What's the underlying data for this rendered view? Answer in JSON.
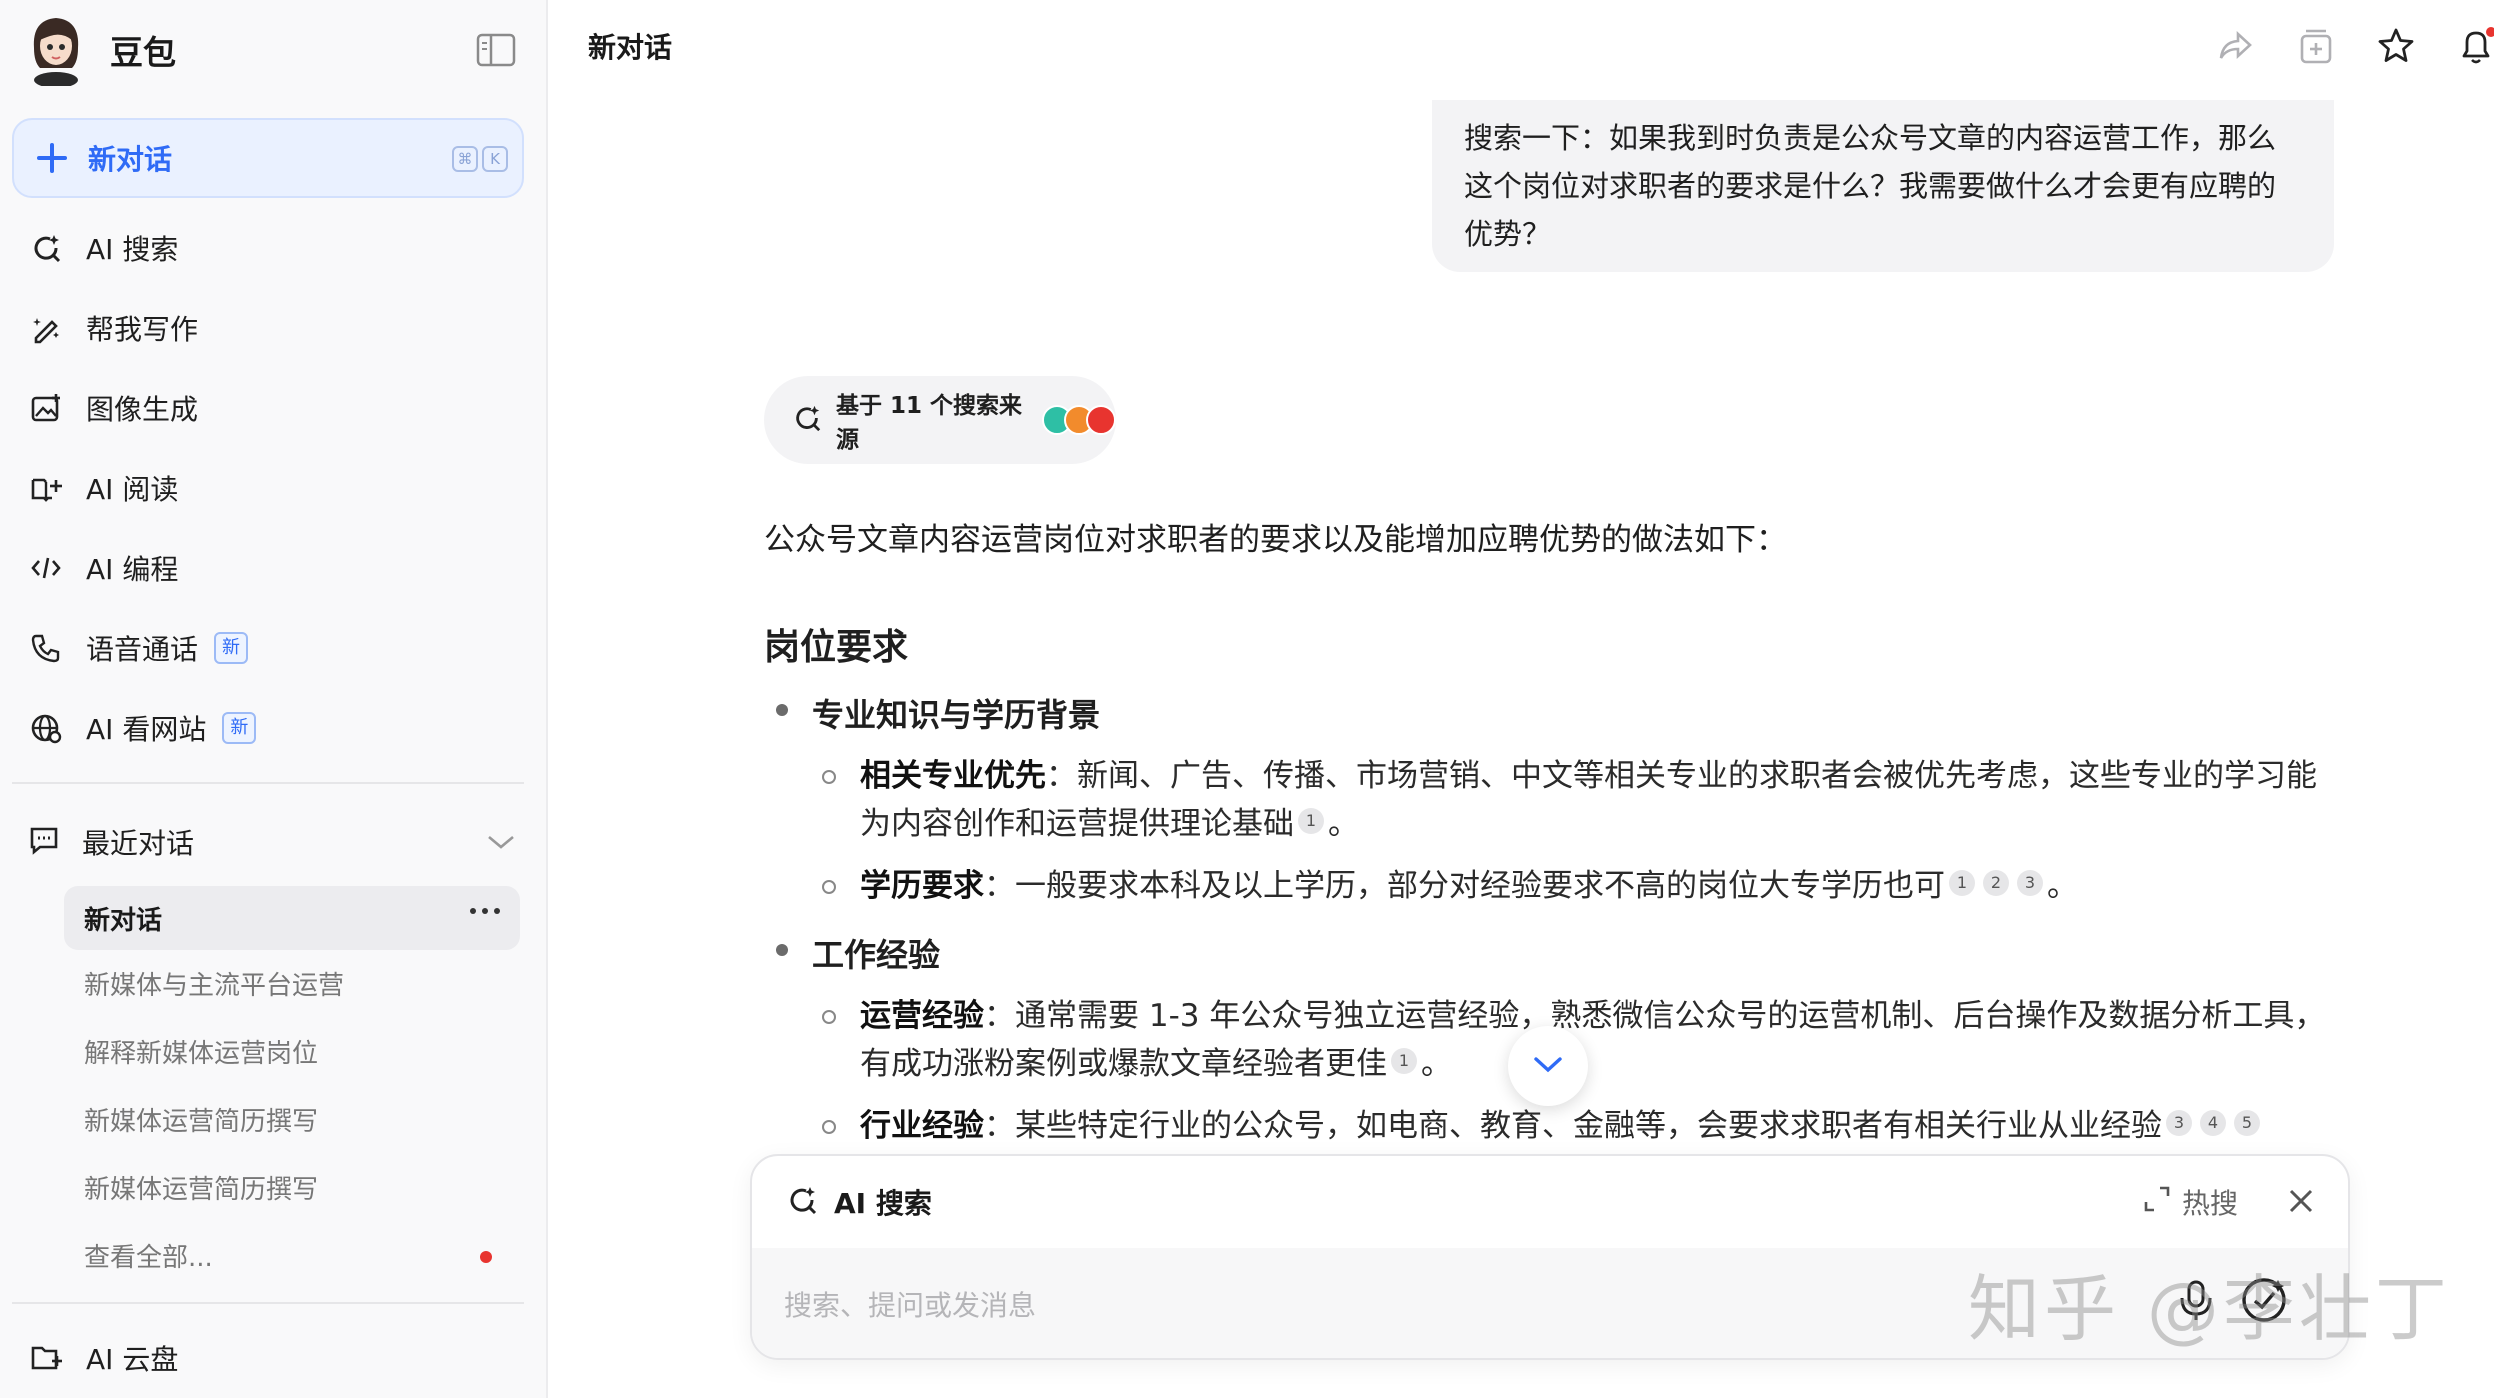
{
  "sidebar": {
    "brand": "豆包",
    "new_chat": "新对话",
    "shortcut": [
      "⌘",
      "K"
    ],
    "nav": [
      {
        "label": "AI 搜索",
        "icon": "ai-search-icon"
      },
      {
        "label": "帮我写作",
        "icon": "write-icon"
      },
      {
        "label": "图像生成",
        "icon": "image-gen-icon"
      },
      {
        "label": "AI 阅读",
        "icon": "read-icon"
      },
      {
        "label": "AI 编程",
        "icon": "code-icon"
      },
      {
        "label": "语音通话",
        "icon": "phone-icon",
        "badge": "新"
      },
      {
        "label": "AI 看网站",
        "icon": "globe-icon",
        "badge": "新"
      }
    ],
    "recent_title": "最近对话",
    "recent": [
      "新对话",
      "新媒体与主流平台运营",
      "解释新媒体运营岗位",
      "新媒体运营简历撰写",
      "新媒体运营简历撰写",
      "查看全部..."
    ],
    "cloud": "AI 云盘"
  },
  "main": {
    "title": "新对话",
    "user_message": "搜索一下：如果我到时负责是公众号文章的内容运营工作，那么这个岗位对求职者的要求是什么？我需要做什么才会更有应聘的优势？",
    "sources": "基于 11 个搜索来源",
    "intro": "公众号文章内容运营岗位对求职者的要求以及能增加应聘优势的做法如下：",
    "heading": "岗位要求",
    "sections": [
      {
        "title": "专业知识与学历背景",
        "items": [
          {
            "bold": "相关专业优先",
            "text": "：新闻、广告、传播、市场营销、中文等相关专业的求职者会被优先考虑，这些专业的学习能为内容创作和运营提供理论基础",
            "cites": [
              "1"
            ],
            "end": "。"
          },
          {
            "bold": "学历要求",
            "text": "：一般要求本科及以上学历，部分对经验要求不高的岗位大专学历也可",
            "cites": [
              "1",
              "2",
              "3"
            ],
            "end": "。"
          }
        ]
      },
      {
        "title": "工作经验",
        "items": [
          {
            "bold": "运营经验",
            "text": "：通常需要 1-3 年公众号独立运营经验，熟悉微信公众号的运营机制、后台操作及数据分析工具，有成功涨粉案例或爆款文章经验者更佳",
            "cites": [
              "1"
            ],
            "end": "。"
          },
          {
            "bold": "行业经验",
            "text": "：某些特定行业的公众号，如电商、教育、金融等，会要求求职者有相关行业从业经验",
            "cites": [
              "3",
              "4",
              "5"
            ],
            "end": ""
          }
        ]
      }
    ]
  },
  "composer": {
    "mode": "AI 搜索",
    "hot": "热搜",
    "placeholder": "搜索、提问或发消息"
  },
  "watermark": "知乎 @李壮丁",
  "colors": {
    "accent": "#2f6bf6",
    "sidebar_bg": "#f9f9fa",
    "bubble_bg": "#f3f3f5"
  }
}
